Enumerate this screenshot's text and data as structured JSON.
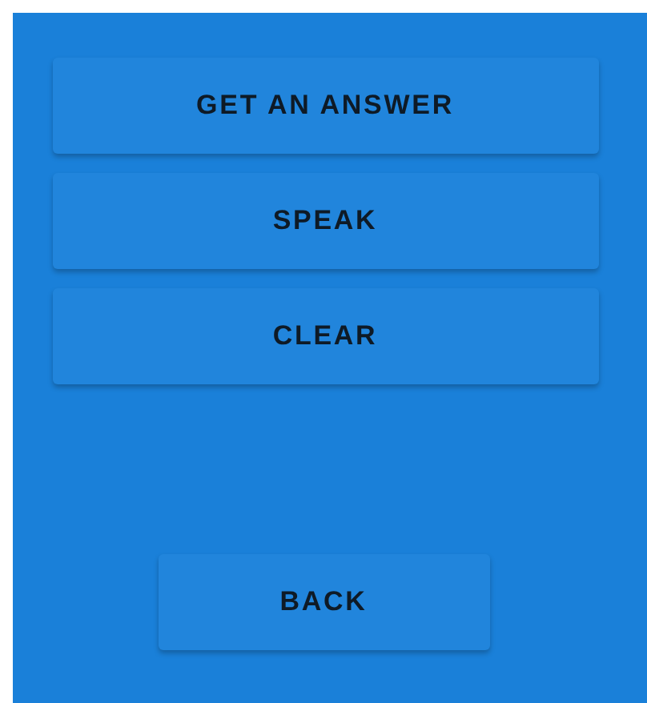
{
  "buttons": [
    {
      "label": "GET AN ANSWER"
    },
    {
      "label": "SPEAK"
    },
    {
      "label": "CLEAR"
    }
  ],
  "back_button": {
    "label": "BACK"
  }
}
